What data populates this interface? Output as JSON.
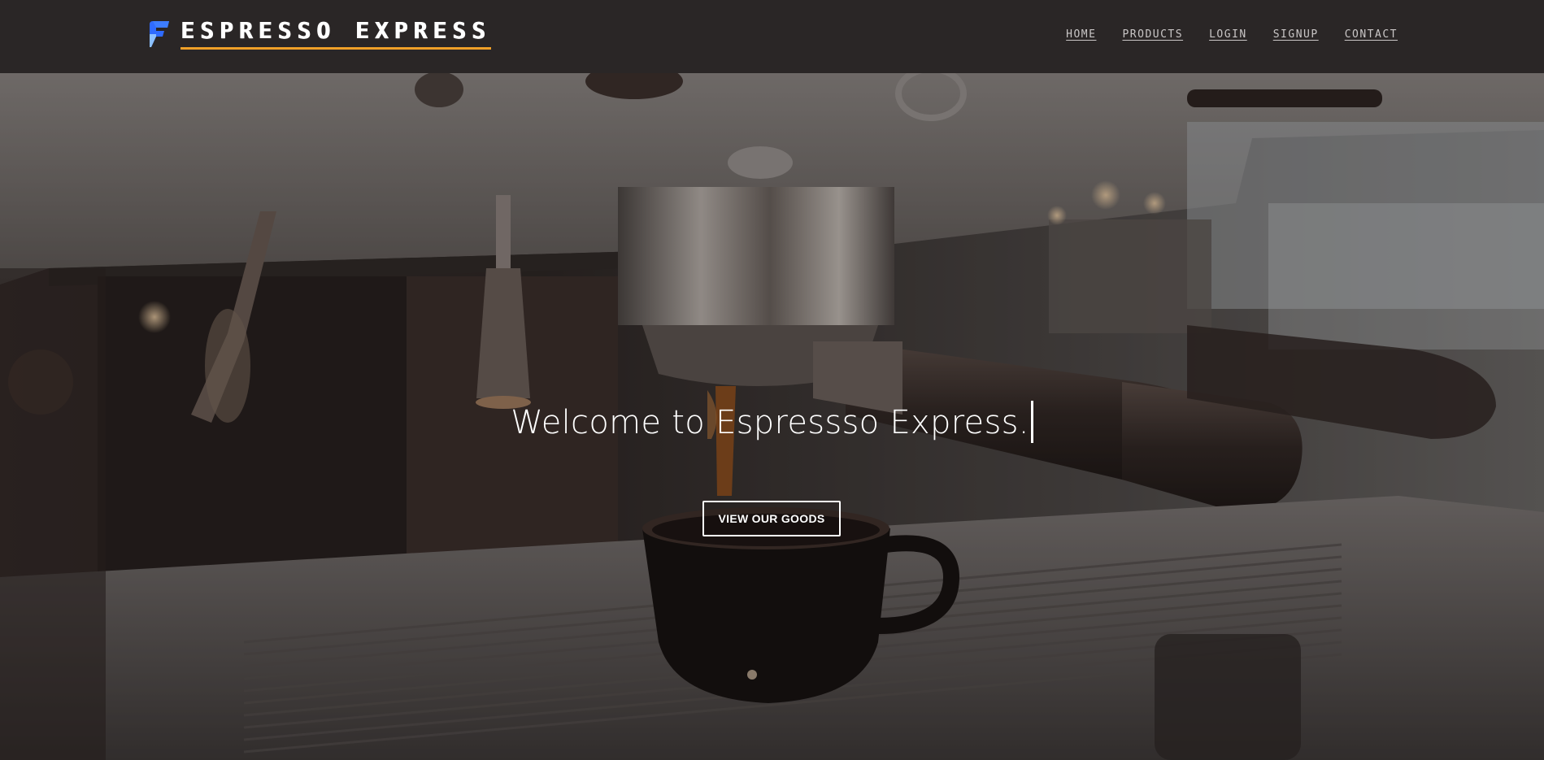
{
  "brand": {
    "name": "ESPRESSO EXPRESS",
    "logo_icon": "f-logo-icon",
    "logo_colors": [
      "#2f6bff",
      "#6aa9ff"
    ],
    "underline_color": "#f0a028"
  },
  "nav": {
    "items": [
      {
        "label": "HOME"
      },
      {
        "label": "PRODUCTS"
      },
      {
        "label": "LOGIN"
      },
      {
        "label": "SIGNUP"
      },
      {
        "label": "CONTACT"
      }
    ]
  },
  "hero": {
    "title": "Welcome to Espressso Express.",
    "button_label": "VIEW OUR GOODS",
    "background": "espresso-machine-photo"
  },
  "colors": {
    "navbar_bg": "#2a2626",
    "nav_text": "#c9c6c6",
    "accent": "#f0a028"
  }
}
